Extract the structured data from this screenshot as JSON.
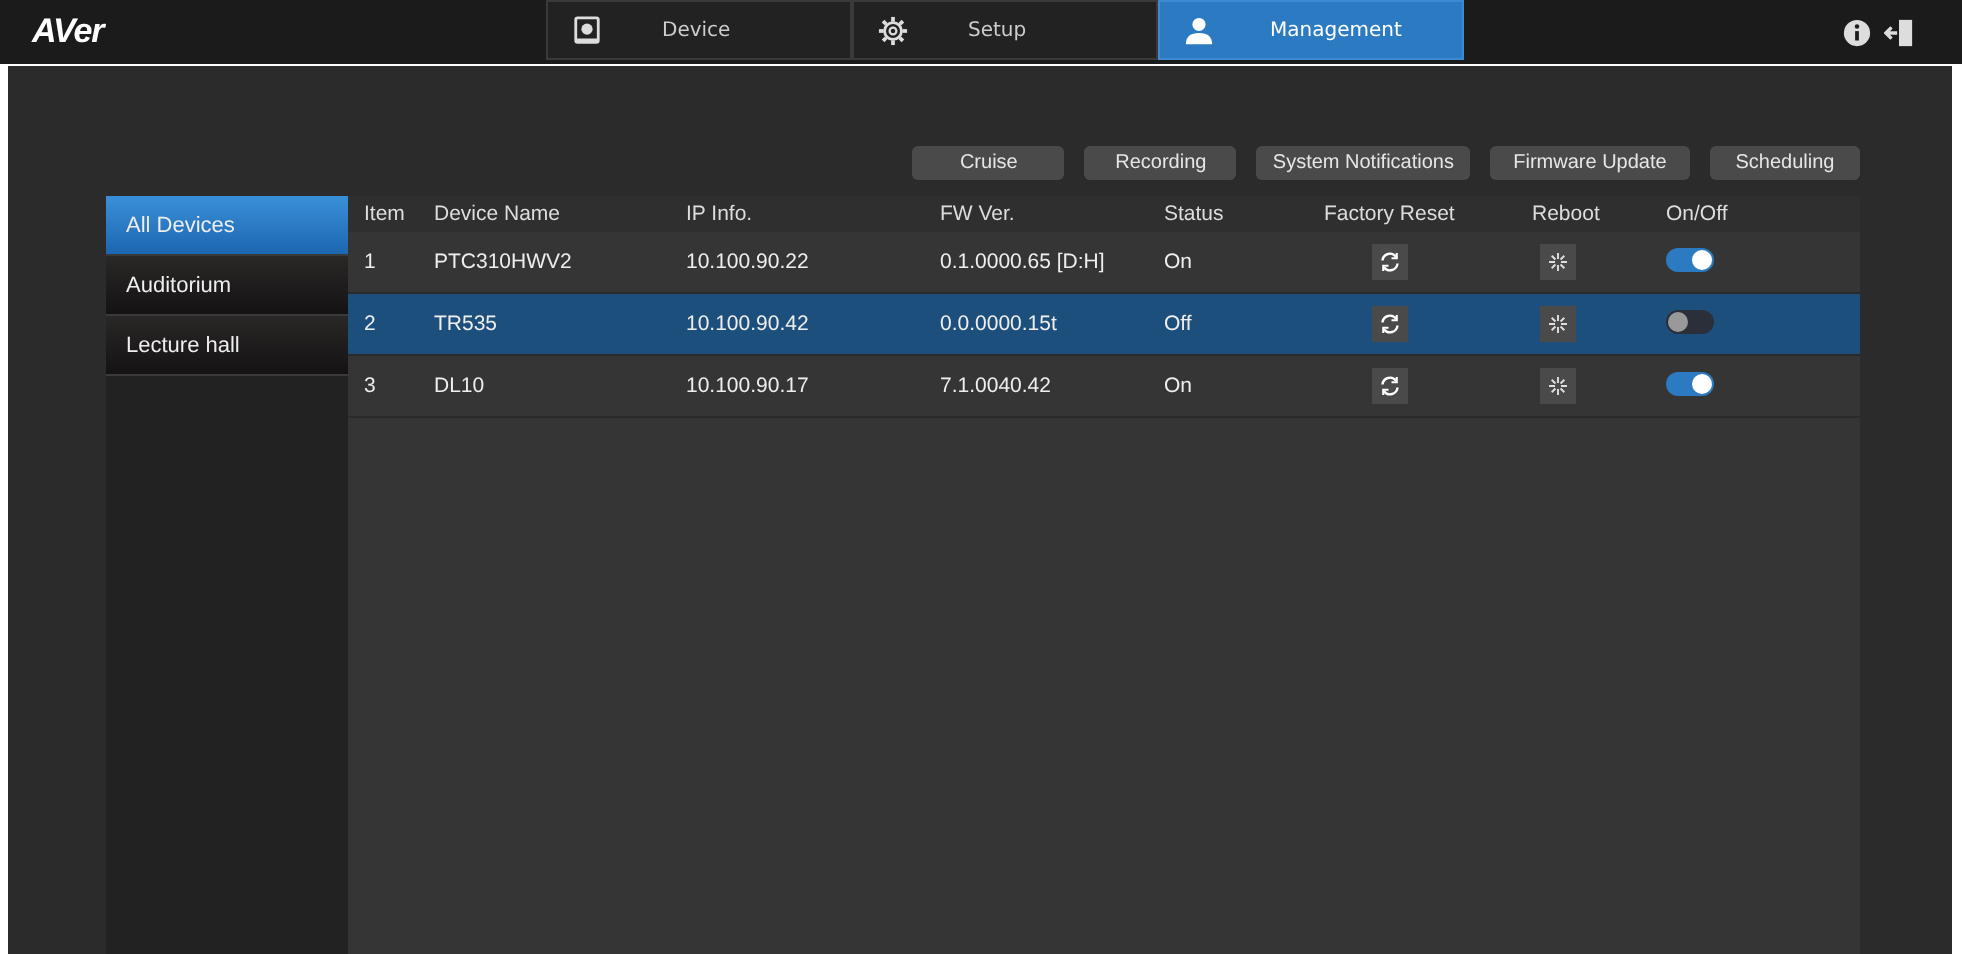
{
  "logo": "AVer",
  "tabs": [
    {
      "label": "Device",
      "kind": "camera",
      "selected": false
    },
    {
      "label": "Setup",
      "kind": "gear",
      "selected": false
    },
    {
      "label": "Management",
      "kind": "user",
      "selected": true
    }
  ],
  "actions": [
    "Cruise",
    "Recording",
    "System Notifications",
    "Firmware Update",
    "Scheduling"
  ],
  "sidebar": {
    "items": [
      {
        "label": "All Devices",
        "selected": true
      },
      {
        "label": "Auditorium",
        "selected": false
      },
      {
        "label": "Lecture hall",
        "selected": false
      }
    ]
  },
  "table": {
    "columns": [
      "Item",
      "Device Name",
      "IP Info.",
      "FW Ver.",
      "Status",
      "Factory Reset",
      "Reboot",
      "On/Off"
    ],
    "rows": [
      {
        "item": "1",
        "name": "PTC310HWV2",
        "ip": "10.100.90.22",
        "fw": "0.1.0000.65 [D:H]",
        "status": "On",
        "selected": false,
        "on": true
      },
      {
        "item": "2",
        "name": "TR535",
        "ip": "10.100.90.42",
        "fw": "0.0.0000.15t",
        "status": "Off",
        "selected": true,
        "on": false
      },
      {
        "item": "3",
        "name": "DL10",
        "ip": "10.100.90.17",
        "fw": "7.1.0040.42",
        "status": "On",
        "selected": false,
        "on": true
      }
    ]
  }
}
